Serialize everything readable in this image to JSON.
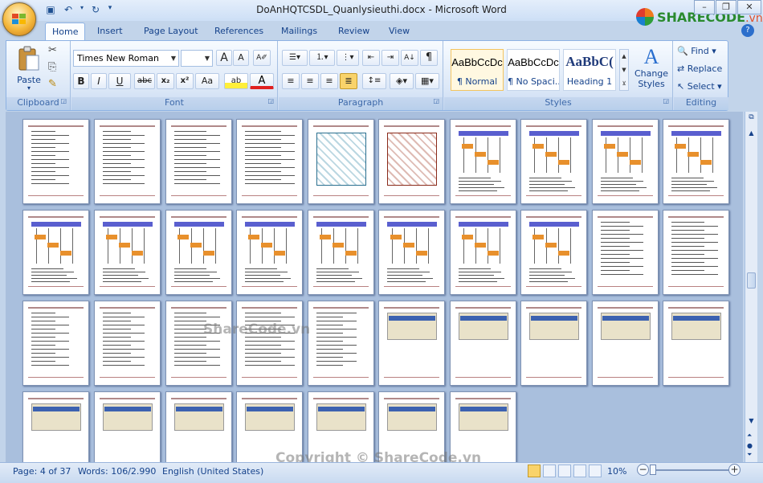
{
  "window": {
    "title": "DoAnHQTCSDL_Quanlysieuthi.docx - Microsoft Word",
    "logo_text": "SHARECODE",
    "logo_tld": ".vn"
  },
  "quick_access": {
    "save": "save-icon",
    "undo": "undo-icon",
    "redo": "redo-icon",
    "customize": "dropdown-icon"
  },
  "tabs": [
    "Home",
    "Insert",
    "Page Layout",
    "References",
    "Mailings",
    "Review",
    "View"
  ],
  "active_tab": "Home",
  "ribbon": {
    "clipboard": {
      "label": "Clipboard",
      "paste": "Paste"
    },
    "font": {
      "label": "Font",
      "family": "Times New Roman",
      "size": "",
      "bold": "B",
      "italic": "I",
      "underline": "U",
      "strike": "abc",
      "subscript": "x₂",
      "superscript": "x²",
      "change_case": "Aa",
      "grow": "A",
      "shrink": "A"
    },
    "paragraph": {
      "label": "Paragraph",
      "sort": "A↓",
      "pilcrow": "¶"
    },
    "styles": {
      "label": "Styles",
      "items": [
        {
          "sample": "AaBbCcDc",
          "name": "¶ Normal"
        },
        {
          "sample": "AaBbCcDc",
          "name": "¶ No Spaci..."
        },
        {
          "sample": "AaBbC(",
          "name": "Heading 1"
        }
      ],
      "change_styles": "Change Styles"
    },
    "editing": {
      "label": "Editing",
      "find": "Find",
      "replace": "Replace",
      "select": "Select"
    }
  },
  "watermarks": {
    "center": "ShareCode.vn",
    "bottom": "Copyright © ShareCode.vn"
  },
  "status": {
    "page": "Page: 4 of 37",
    "words": "Words: 106/2.990",
    "language": "English (United States)",
    "zoom": "10%",
    "zoom_minus": "−",
    "zoom_plus": "+"
  },
  "pages": {
    "total": 37,
    "rows": [
      10,
      10,
      10,
      7
    ]
  },
  "colors": {
    "accent": "#15428b",
    "ribbon_border": "#8db2e3",
    "workspace": "#a9bfdd"
  }
}
